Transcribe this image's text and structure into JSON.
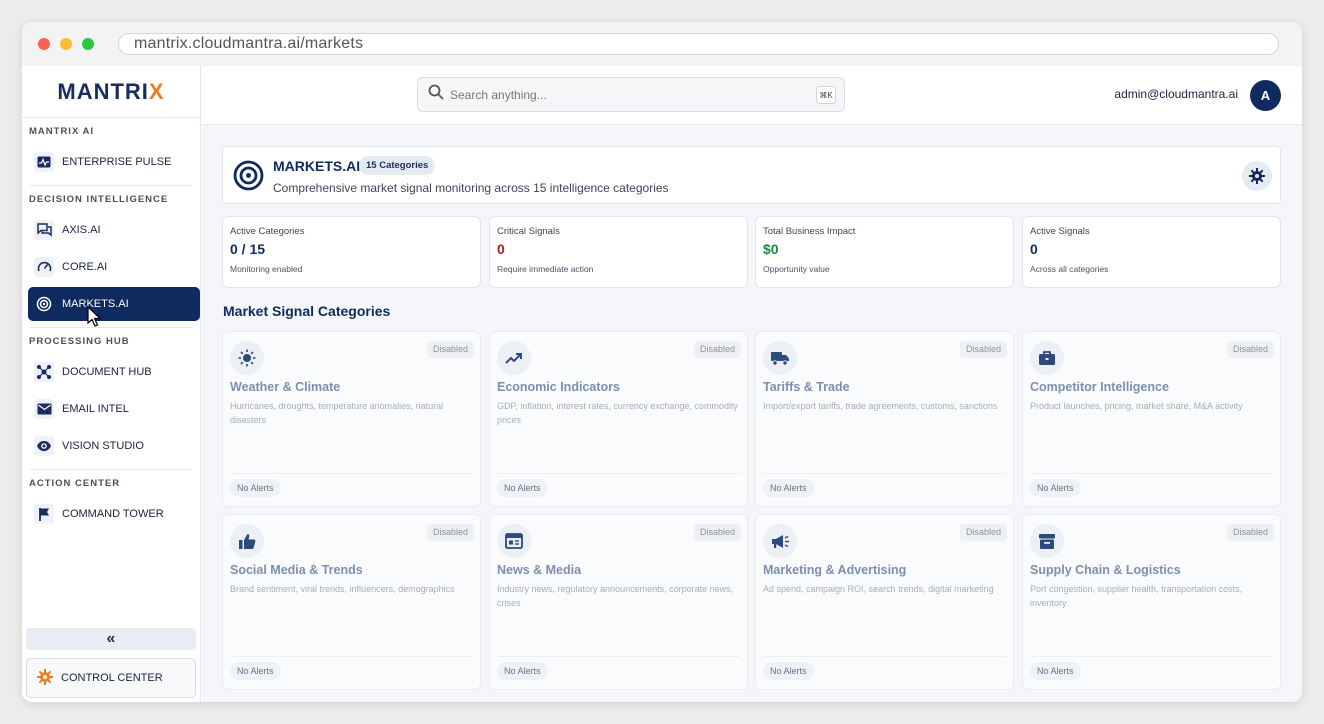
{
  "browser": {
    "url": "mantrix.cloudmantra.ai/markets"
  },
  "brand": {
    "logo_text_pre": "MANTRI",
    "logo_text_x": "X",
    "accent": "#f07c22",
    "primary": "#0f2a5e"
  },
  "sidebar": {
    "sections": [
      {
        "label": "MANTRIX AI",
        "items": [
          {
            "label": "ENTERPRISE PULSE",
            "icon": "pulse-icon"
          }
        ]
      },
      {
        "label": "DECISION INTELLIGENCE",
        "items": [
          {
            "label": "AXIS.AI",
            "icon": "chat-icon"
          },
          {
            "label": "CORE.AI",
            "icon": "gauge-icon"
          },
          {
            "label": "MARKETS.AI",
            "icon": "radar-icon",
            "active": true
          }
        ]
      },
      {
        "label": "PROCESSING HUB",
        "items": [
          {
            "label": "DOCUMENT HUB",
            "icon": "hub-icon"
          },
          {
            "label": "EMAIL INTEL",
            "icon": "mail-icon"
          },
          {
            "label": "VISION STUDIO",
            "icon": "eye-icon"
          }
        ]
      },
      {
        "label": "ACTION CENTER",
        "items": [
          {
            "label": "COMMAND TOWER",
            "icon": "flag-icon"
          }
        ]
      }
    ],
    "collapse_icon": "«",
    "control_center": "CONTROL CENTER"
  },
  "topbar": {
    "search_placeholder": "Search anything...",
    "shortcut": "⌘K",
    "user_email": "admin@cloudmantra.ai",
    "avatar_initial": "A"
  },
  "header": {
    "title": "MARKETS.AI",
    "badge": "15 Categories",
    "description": "Comprehensive market signal monitoring across 15 intelligence categories"
  },
  "stats": [
    {
      "label": "Active Categories",
      "value": "0 / 15",
      "sub": "Monitoring enabled",
      "tone": "navy"
    },
    {
      "label": "Critical Signals",
      "value": "0",
      "sub": "Require immediate action",
      "tone": "red"
    },
    {
      "label": "Total Business Impact",
      "value": "$0",
      "sub": "Opportunity value",
      "tone": "green"
    },
    {
      "label": "Active Signals",
      "value": "0",
      "sub": "Across all categories",
      "tone": "navy"
    }
  ],
  "categories_title": "Market Signal Categories",
  "categories": [
    {
      "name": "Weather & Climate",
      "desc": "Hurricanes, droughts, temperature anomalies, natural disasters",
      "status": "Disabled",
      "alerts": "No Alerts",
      "icon": "sun-icon"
    },
    {
      "name": "Economic Indicators",
      "desc": "GDP, inflation, interest rates, currency exchange, commodity prices",
      "status": "Disabled",
      "alerts": "No Alerts",
      "icon": "trend-up-icon"
    },
    {
      "name": "Tariffs & Trade",
      "desc": "Import/export tariffs, trade agreements, customs, sanctions",
      "status": "Disabled",
      "alerts": "No Alerts",
      "icon": "truck-icon"
    },
    {
      "name": "Competitor Intelligence",
      "desc": "Product launches, pricing, market share, M&A activity",
      "status": "Disabled",
      "alerts": "No Alerts",
      "icon": "briefcase-icon"
    },
    {
      "name": "Social Media & Trends",
      "desc": "Brand sentiment, viral trends, influencers, demographics",
      "status": "Disabled",
      "alerts": "No Alerts",
      "icon": "thumbs-up-icon"
    },
    {
      "name": "News & Media",
      "desc": "Industry news, regulatory announcements, corporate news, crises",
      "status": "Disabled",
      "alerts": "No Alerts",
      "icon": "newspaper-icon"
    },
    {
      "name": "Marketing & Advertising",
      "desc": "Ad spend, campaign ROI, search trends, digital marketing",
      "status": "Disabled",
      "alerts": "No Alerts",
      "icon": "megaphone-icon"
    },
    {
      "name": "Supply Chain & Logistics",
      "desc": "Port congestion, supplier health, transportation costs, inventory",
      "status": "Disabled",
      "alerts": "No Alerts",
      "icon": "archive-icon"
    }
  ]
}
